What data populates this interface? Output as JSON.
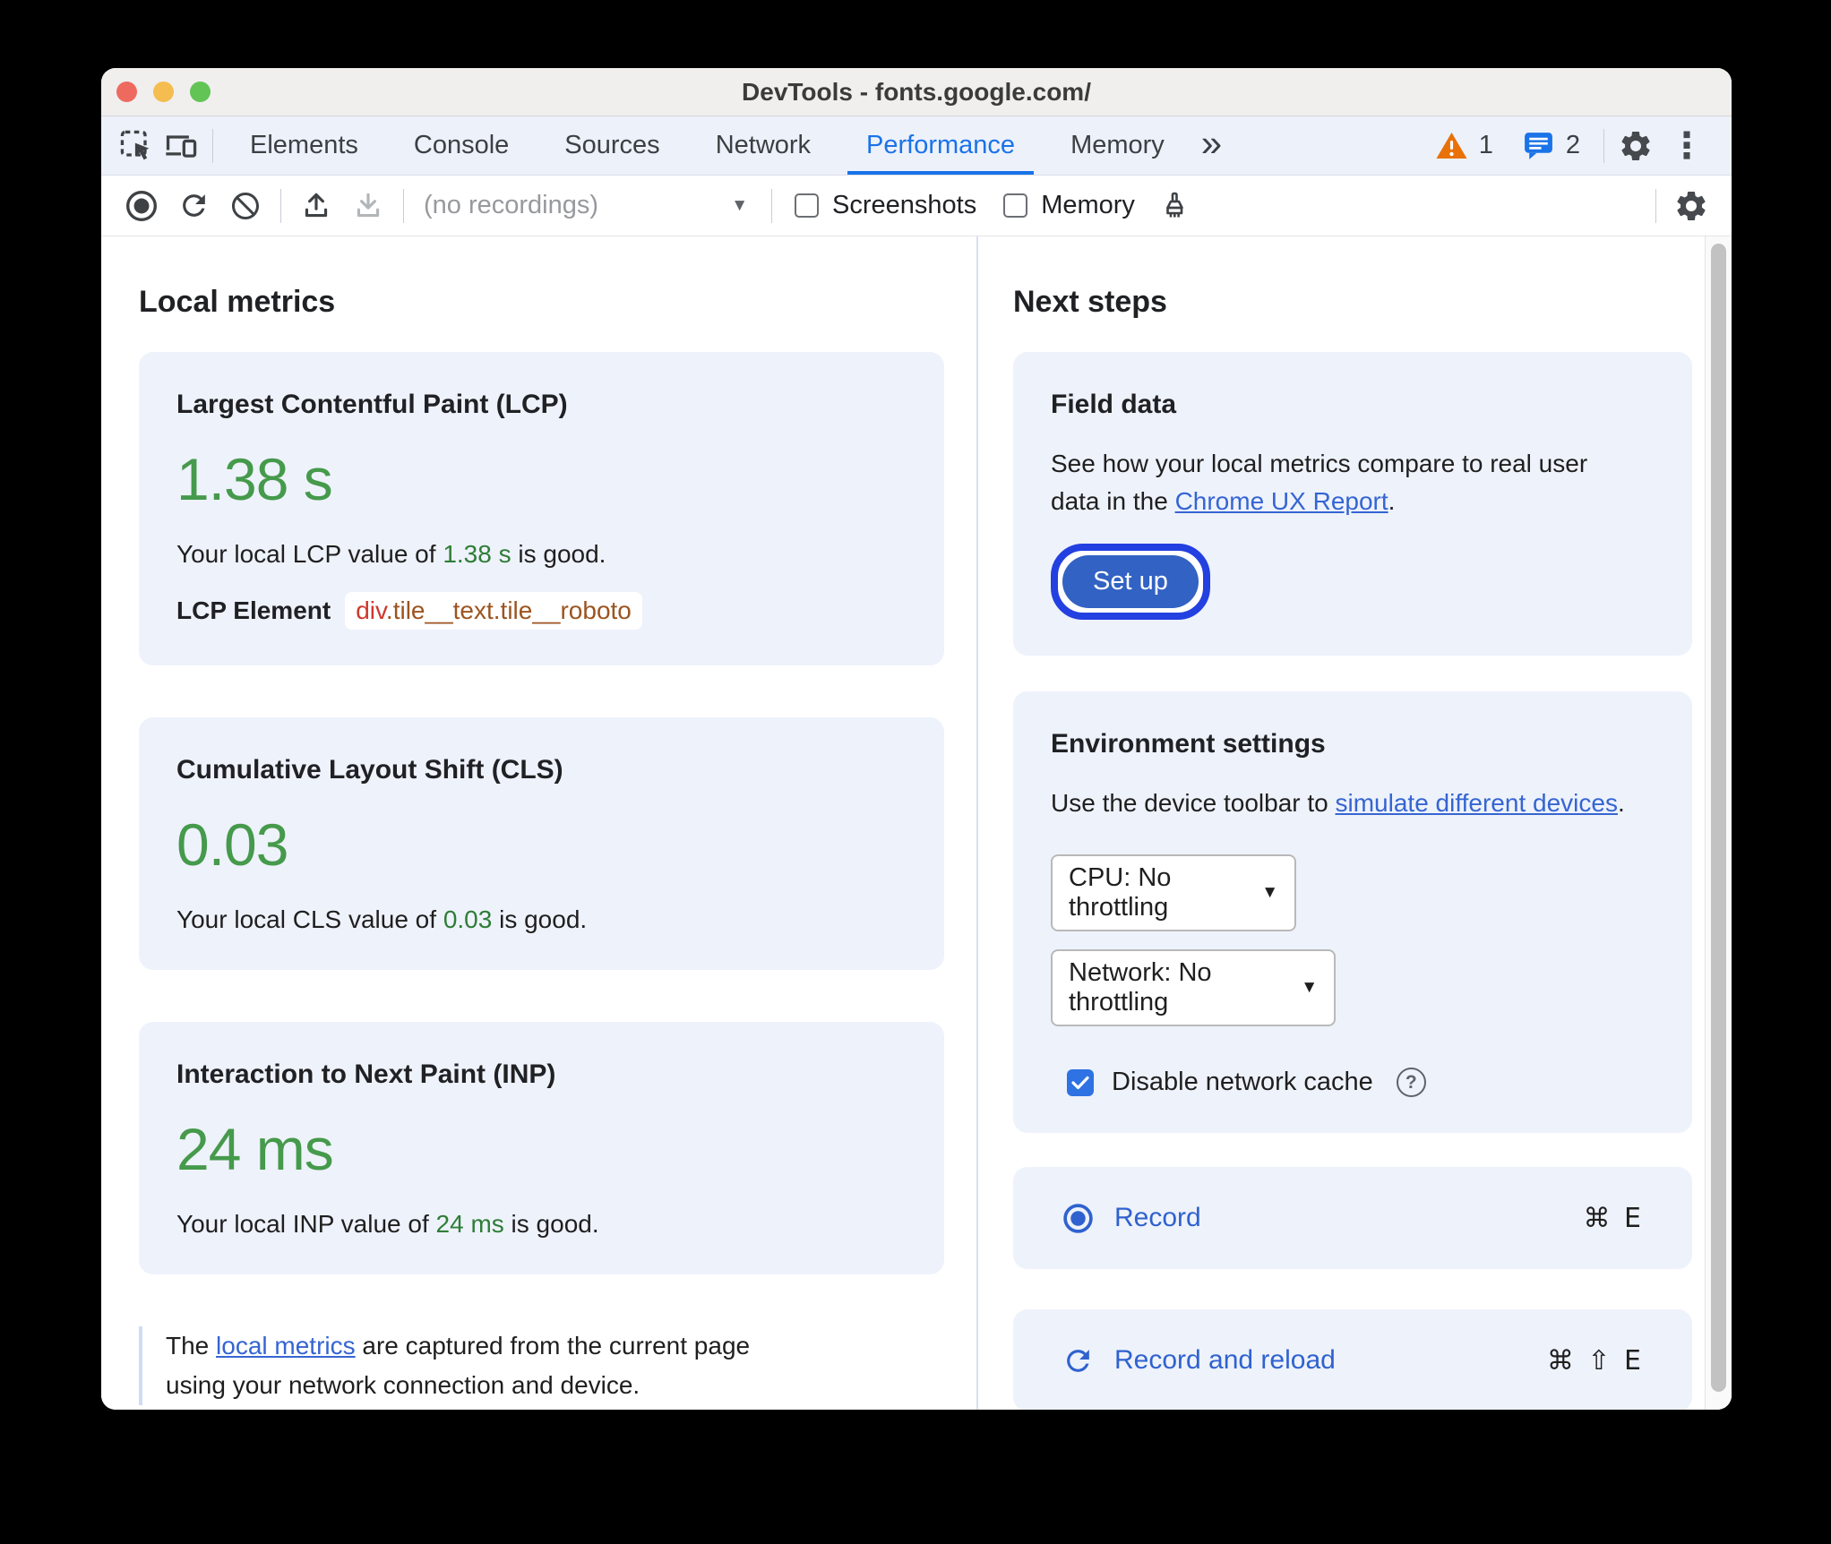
{
  "colors": {
    "accent_blue": "#1a73e8",
    "link_blue": "#3565d2",
    "action_blue": "#2f62cf",
    "good_green_large": "#459a4b",
    "good_green_inline": "#2e7d36",
    "warning_orange": "#e8710a",
    "card_background": "#eef2fb",
    "element_tag_red": "#cf372c",
    "element_class_brown": "#9c5420",
    "setup_button_fill": "#3262c3",
    "setup_focus_ring": "#2340e0"
  },
  "icons": {
    "caret_down": "▼",
    "help": "?",
    "more_tabs": "»",
    "overflow_menu": "⋮"
  },
  "titlebar": {
    "title": "DevTools - fonts.google.com/"
  },
  "tabbar": {
    "tabs": [
      "Elements",
      "Console",
      "Sources",
      "Network",
      "Performance",
      "Memory"
    ],
    "active_tab": "Performance",
    "warning_count": "1",
    "message_count": "2"
  },
  "toolbar": {
    "recordings_dropdown": "(no recordings)",
    "screenshots_label": "Screenshots",
    "memory_label": "Memory"
  },
  "local_metrics": {
    "heading": "Local metrics",
    "cards": [
      {
        "title": "Largest Contentful Paint (LCP)",
        "value": "1.38 s",
        "desc_prefix": "Your local LCP value of ",
        "desc_value": "1.38 s",
        "desc_suffix": " is good.",
        "element_label": "LCP Element",
        "element_tag": "div",
        "element_classes": ".tile__text.tile__roboto"
      },
      {
        "title": "Cumulative Layout Shift (CLS)",
        "value": "0.03",
        "desc_prefix": "Your local CLS value of ",
        "desc_value": "0.03",
        "desc_suffix": " is good."
      },
      {
        "title": "Interaction to Next Paint (INP)",
        "value": "24 ms",
        "desc_prefix": "Your local INP value of ",
        "desc_value": "24 ms",
        "desc_suffix": " is good."
      }
    ],
    "footnote_prefix": "The ",
    "footnote_link": "local metrics",
    "footnote_suffix": " are captured from the current page using your network connection and device."
  },
  "next_steps": {
    "heading": "Next steps",
    "field_data": {
      "title": "Field data",
      "body_before": "See how your local metrics compare to real user data in the ",
      "body_link": "Chrome UX Report",
      "body_after": ".",
      "button_label": "Set up"
    },
    "environment": {
      "title": "Environment settings",
      "body_before": "Use the device toolbar to ",
      "body_link": "simulate different devices",
      "body_after": ".",
      "cpu_value": "CPU: No throttling",
      "network_value": "Network: No throttling",
      "cache_label": "Disable network cache"
    },
    "actions": [
      {
        "label": "Record",
        "shortcut": "⌘ E"
      },
      {
        "label": "Record and reload",
        "shortcut": "⌘ ⇧ E"
      }
    ]
  }
}
